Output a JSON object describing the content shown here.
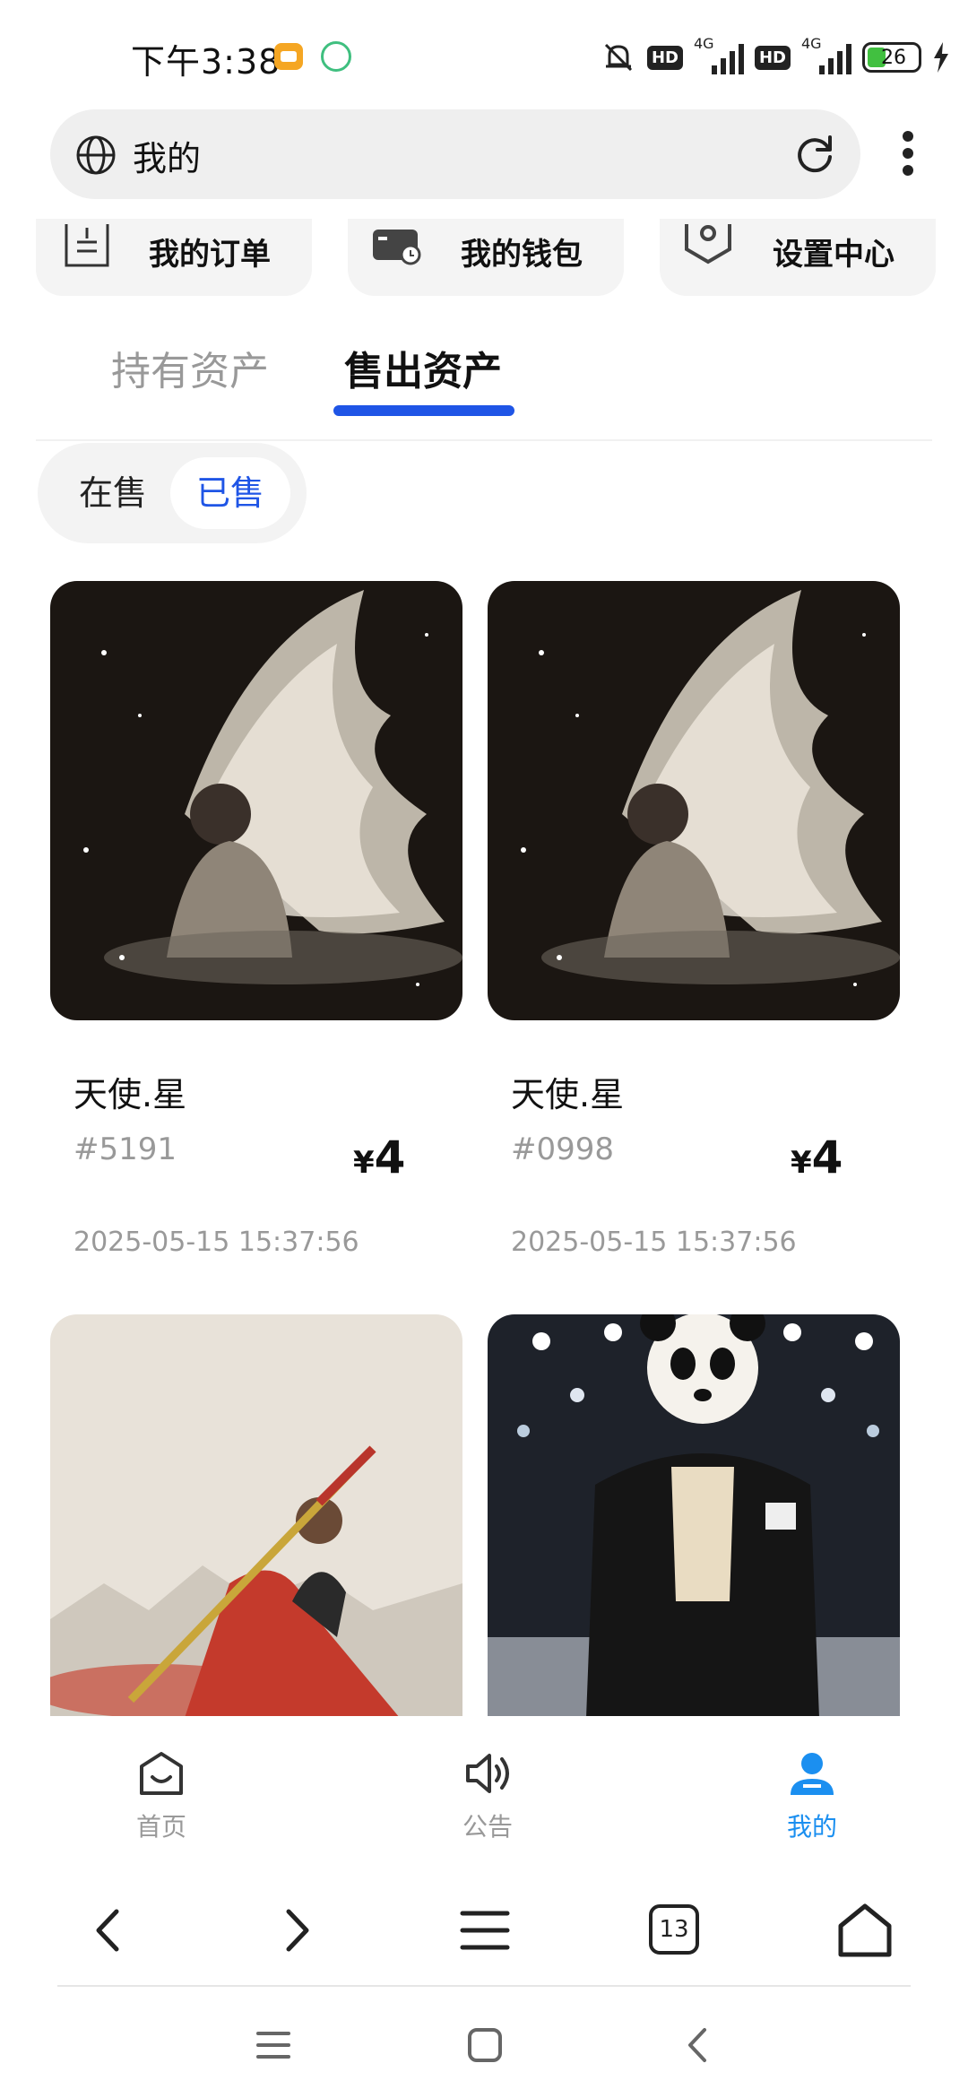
{
  "status_bar": {
    "time": "下午3:38",
    "battery": "26"
  },
  "address_bar": {
    "text": "我的"
  },
  "quick_actions": [
    {
      "label": "我的订单",
      "icon": "order-icon"
    },
    {
      "label": "我的钱包",
      "icon": "wallet-icon"
    },
    {
      "label": "设置中心",
      "icon": "settings-icon"
    }
  ],
  "asset_tabs": {
    "held": "持有资产",
    "sold": "售出资产",
    "active": "sold"
  },
  "sale_filter": {
    "on_sale": "在售",
    "sold": "已售",
    "active": "sold"
  },
  "items": [
    {
      "name": "天使.星",
      "serial": "#5191",
      "currency": "¥",
      "price": "4",
      "time": "2025-05-15 15:37:56"
    },
    {
      "name": "天使.星",
      "serial": "#0998",
      "currency": "¥",
      "price": "4",
      "time": "2025-05-15 15:37:56"
    },
    {
      "name": "",
      "serial": "",
      "currency": "",
      "price": "",
      "time": ""
    },
    {
      "name": "",
      "serial": "",
      "currency": "",
      "price": "",
      "time": ""
    }
  ],
  "bottom_nav": [
    {
      "label": "首页",
      "icon": "home-icon",
      "active": false
    },
    {
      "label": "公告",
      "icon": "speaker-icon",
      "active": false
    },
    {
      "label": "我的",
      "icon": "user-icon",
      "active": true
    }
  ],
  "browser_toolbar": {
    "tab_count": "13"
  },
  "colors": {
    "accent": "#1f55e6",
    "nav_active": "#1b8ff0",
    "muted": "#999999"
  }
}
